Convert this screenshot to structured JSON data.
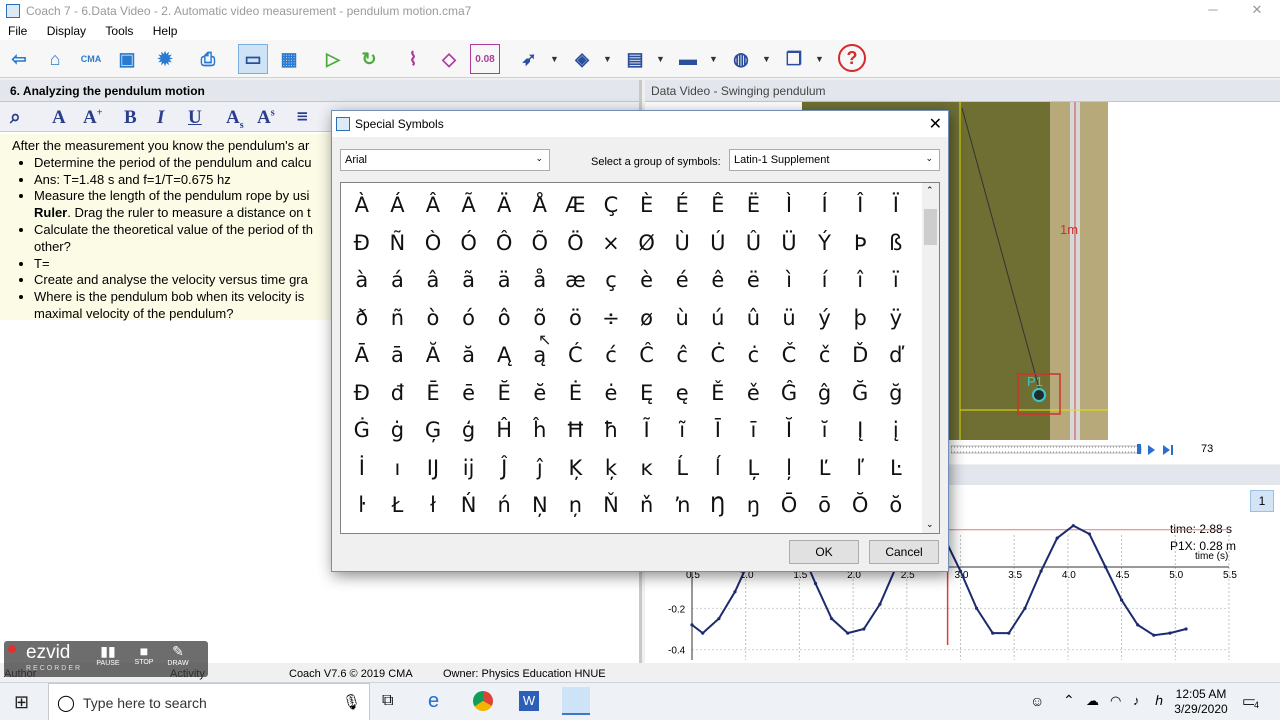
{
  "window": {
    "title": "Coach 7 - 6.Data Video - 2. Automatic video measurement - pendulum motion.cma7",
    "controls": [
      "─",
      "❐",
      "✕"
    ]
  },
  "menu": [
    "File",
    "Display",
    "Tools",
    "Help"
  ],
  "toolbar_icons": [
    "back-icon",
    "open-icon",
    "cma-icon",
    "save-icon",
    "settings-icon",
    "print-icon",
    "screen-icon",
    "table-icon",
    "play-icon",
    "refresh-icon",
    "graph-icon",
    "analysis-icon",
    "value-icon",
    "run-icon",
    "edit-icon",
    "image-icon",
    "monitor-icon",
    "globe-icon",
    "document-icon",
    "help-icon"
  ],
  "toolbar_text": {
    "cma": "CMA",
    "value": "0.08"
  },
  "left_panel": {
    "title": "6. Analyzing the pendulum motion",
    "intro": "After the measurement you know the pendulum's ar",
    "bullets": [
      {
        "pre": "Determine the period of the pendulum and calcu",
        "bold": "",
        "post": ""
      },
      {
        "pre": "Ans: T=1.48 s and f=1/T=0.675 hz",
        "bold": "",
        "post": ""
      },
      {
        "pre": "Measure the length of the pendulum rope by usi",
        "bold": "Ruler",
        "post": ". Drag the ruler to measure a distance on t"
      },
      {
        "pre": "Calculate the theoretical value of the period of th",
        "bold": "",
        "post": " other?"
      },
      {
        "pre": "T=",
        "bold": "",
        "post": ""
      },
      {
        "pre": "Create and analyse the velocity versus time gra",
        "bold": "",
        "post": ""
      },
      {
        "pre": "Where is the pendulum bob when its velocity is",
        "bold": "",
        "post": " maximal velocity of the pendulum?"
      }
    ]
  },
  "video_panel": {
    "title": "Data Video - Swinging pendulum",
    "ruler_label": "1m",
    "point_label": "P1",
    "frame": "73"
  },
  "graph_panel": {
    "page": "1",
    "readout_time": "time: 2.88 s",
    "readout_p1x": "P1X: 0.28 m",
    "x_unit": "time (s)",
    "x_ticks": [
      0.5,
      1.0,
      1.5,
      2.0,
      2.5,
      3.0,
      3.5,
      4.0,
      4.5,
      5.0,
      5.5
    ],
    "x_tick_labels": [
      "0.5",
      "1.0",
      "1.5",
      "2.0",
      "2.5",
      "3.0",
      "3.5",
      "4.0",
      "4.5",
      "5.0",
      "5.5"
    ],
    "y_ticks": [
      0.0,
      -0.2,
      -0.4
    ],
    "y_tick_labels": [
      "0.0",
      "-0.2",
      "-0.4"
    ]
  },
  "chart_data": {
    "type": "line",
    "xlabel": "time (s)",
    "ylabel": "",
    "xlim": [
      0.5,
      5.5
    ],
    "ylim": [
      -0.45,
      0.3
    ],
    "series": [
      {
        "x": [
          0.5,
          0.6,
          0.75,
          0.9,
          1.05,
          1.2,
          1.35,
          1.5,
          1.65,
          1.8,
          1.95,
          2.1,
          2.25,
          2.4,
          2.55,
          2.7,
          2.85,
          3.0,
          3.15,
          3.3,
          3.45,
          3.6,
          3.75,
          3.9,
          4.05,
          4.2,
          4.35,
          4.5,
          4.65,
          4.8,
          4.95,
          5.1
        ],
        "y": [
          -0.28,
          -0.32,
          -0.25,
          -0.12,
          0.05,
          0.18,
          0.2,
          0.1,
          -0.08,
          -0.25,
          -0.32,
          -0.3,
          -0.18,
          0.0,
          0.15,
          0.2,
          0.14,
          -0.02,
          -0.2,
          -0.32,
          -0.32,
          -0.2,
          -0.02,
          0.14,
          0.2,
          0.16,
          0.0,
          -0.16,
          -0.28,
          -0.33,
          -0.32,
          -0.3
        ]
      }
    ],
    "cursor_x": 2.88,
    "hline_y": 0.18
  },
  "dialog": {
    "title": "Special Symbols",
    "font": "Arial",
    "group_label": "Select a group of symbols:",
    "group": "Latin-1 Supplement",
    "symbols": [
      [
        "À",
        "Á",
        "Â",
        "Ã",
        "Ä",
        "Å",
        "Æ",
        "Ç",
        "È",
        "É",
        "Ê",
        "Ë",
        "Ì",
        "Í",
        "Î",
        "Ï"
      ],
      [
        "Ð",
        "Ñ",
        "Ò",
        "Ó",
        "Ô",
        "Õ",
        "Ö",
        "×",
        "Ø",
        "Ù",
        "Ú",
        "Û",
        "Ü",
        "Ý",
        "Þ",
        "ß"
      ],
      [
        "à",
        "á",
        "â",
        "ã",
        "ä",
        "å",
        "æ",
        "ç",
        "è",
        "é",
        "ê",
        "ë",
        "ì",
        "í",
        "î",
        "ï"
      ],
      [
        "ð",
        "ñ",
        "ò",
        "ó",
        "ô",
        "õ",
        "ö",
        "÷",
        "ø",
        "ù",
        "ú",
        "û",
        "ü",
        "ý",
        "þ",
        "ÿ"
      ],
      [
        "Ā",
        "ā",
        "Ă",
        "ă",
        "Ą",
        "ą",
        "Ć",
        "ć",
        "Ĉ",
        "ĉ",
        "Ċ",
        "ċ",
        "Č",
        "č",
        "Ď",
        "ď"
      ],
      [
        "Đ",
        "đ",
        "Ē",
        "ē",
        "Ĕ",
        "ĕ",
        "Ė",
        "ė",
        "Ę",
        "ę",
        "Ě",
        "ě",
        "Ĝ",
        "ĝ",
        "Ğ",
        "ğ"
      ],
      [
        "Ġ",
        "ġ",
        "Ģ",
        "ģ",
        "Ĥ",
        "ĥ",
        "Ħ",
        "ħ",
        "Ĩ",
        "ĩ",
        "Ī",
        "ī",
        "Ĭ",
        "ĭ",
        "Į",
        "į"
      ],
      [
        "İ",
        "ı",
        "Ĳ",
        "ĳ",
        "Ĵ",
        "ĵ",
        "Ķ",
        "ķ",
        "ĸ",
        "Ĺ",
        "ĺ",
        "Ļ",
        "ļ",
        "Ľ",
        "ľ",
        "Ŀ"
      ],
      [
        "ŀ",
        "Ł",
        "ł",
        "Ń",
        "ń",
        "Ņ",
        "ņ",
        "Ň",
        "ň",
        "ŉ",
        "Ŋ",
        "ŋ",
        "Ō",
        "ō",
        "Ŏ",
        "ŏ"
      ]
    ],
    "ok": "OK",
    "cancel": "Cancel"
  },
  "statusbar": {
    "author": "Author",
    "activity": "Activity",
    "version": "Coach V7.6 © 2019 CMA",
    "owner": "Owner: Physics Education HNUE"
  },
  "ezvid": {
    "brand": "ezvid",
    "sub": "RECORDER",
    "pause": "PAUSE",
    "stop": "STOP",
    "draw": "DRAW"
  },
  "taskbar": {
    "search_placeholder": "Type here to search",
    "time": "12:05 AM",
    "date": "3/29/2020",
    "notifications": "4"
  }
}
